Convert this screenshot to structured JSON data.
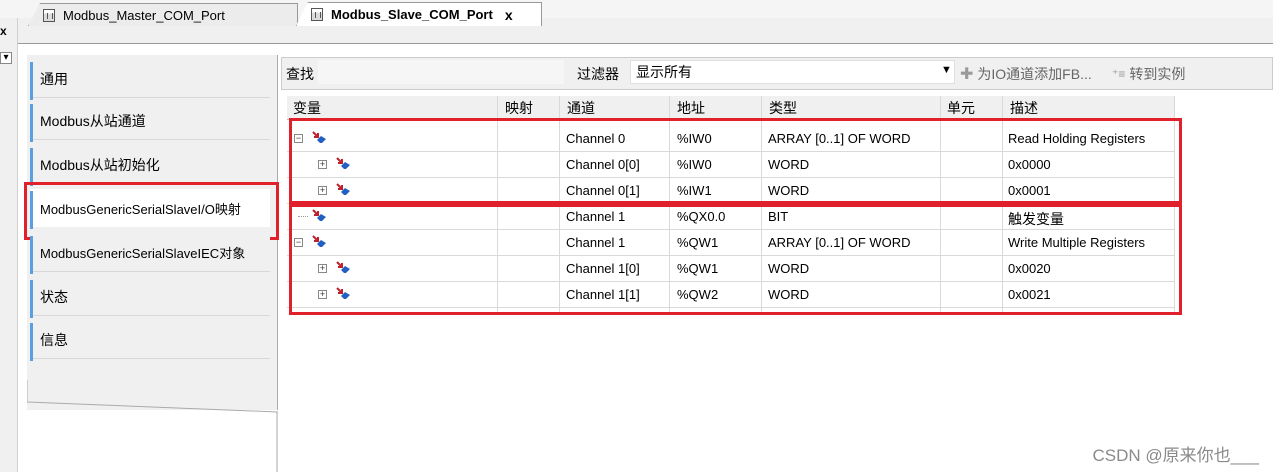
{
  "tabs": [
    {
      "label": "Modbus_Master_COM_Port",
      "active": false
    },
    {
      "label": "Modbus_Slave_COM_Port",
      "active": true
    }
  ],
  "tab_close": "x",
  "sidebar": {
    "items": [
      {
        "label": "通用"
      },
      {
        "label": "Modbus从站通道"
      },
      {
        "label": "Modbus从站初始化"
      },
      {
        "label": "ModbusGenericSerialSlaveI/O映射",
        "selected": true
      },
      {
        "label": "ModbusGenericSerialSlaveIEC对象"
      },
      {
        "label": "状态"
      },
      {
        "label": "信息"
      }
    ]
  },
  "toolbar": {
    "search_label": "查找",
    "filter_label": "过滤器",
    "filter_value": "显示所有",
    "add_fb_label": "为IO通道添加FB...",
    "goto_instance_label": "转到实例"
  },
  "table": {
    "columns": [
      "变量",
      "映射",
      "通道",
      "地址",
      "类型",
      "单元",
      "描述"
    ],
    "rows": [
      {
        "channel": "Channel 0",
        "address": "%IW0",
        "type": "ARRAY [0..1] OF WORD",
        "description": "Read Holding Registers",
        "level": 0,
        "expander": "−",
        "dir": "in"
      },
      {
        "channel": "Channel 0[0]",
        "address": "%IW0",
        "type": "WORD",
        "description": "0x0000",
        "level": 1,
        "expander": "+",
        "dir": "in"
      },
      {
        "channel": "Channel 0[1]",
        "address": "%IW1",
        "type": "WORD",
        "description": "0x0001",
        "level": 1,
        "expander": "+",
        "dir": "in"
      },
      {
        "channel": "Channel 1",
        "address": "%QX0.0",
        "type": "BIT",
        "description": "触发变量",
        "level": 0,
        "expander": "",
        "dir": "out"
      },
      {
        "channel": "Channel 1",
        "address": "%QW1",
        "type": "ARRAY [0..1] OF WORD",
        "description": "Write Multiple Registers",
        "level": 0,
        "expander": "−",
        "dir": "out"
      },
      {
        "channel": "Channel 1[0]",
        "address": "%QW1",
        "type": "WORD",
        "description": "0x0020",
        "level": 1,
        "expander": "+",
        "dir": "out"
      },
      {
        "channel": "Channel 1[1]",
        "address": "%QW2",
        "type": "WORD",
        "description": "0x0021",
        "level": 1,
        "expander": "+",
        "dir": "out"
      }
    ]
  },
  "watermark": "CSDN @原来你也___",
  "colors": {
    "highlight_red": "#e0202a",
    "nav_accent": "#5aa0e0",
    "icon_in": "#c0202a",
    "icon_out": "#2060c0"
  }
}
